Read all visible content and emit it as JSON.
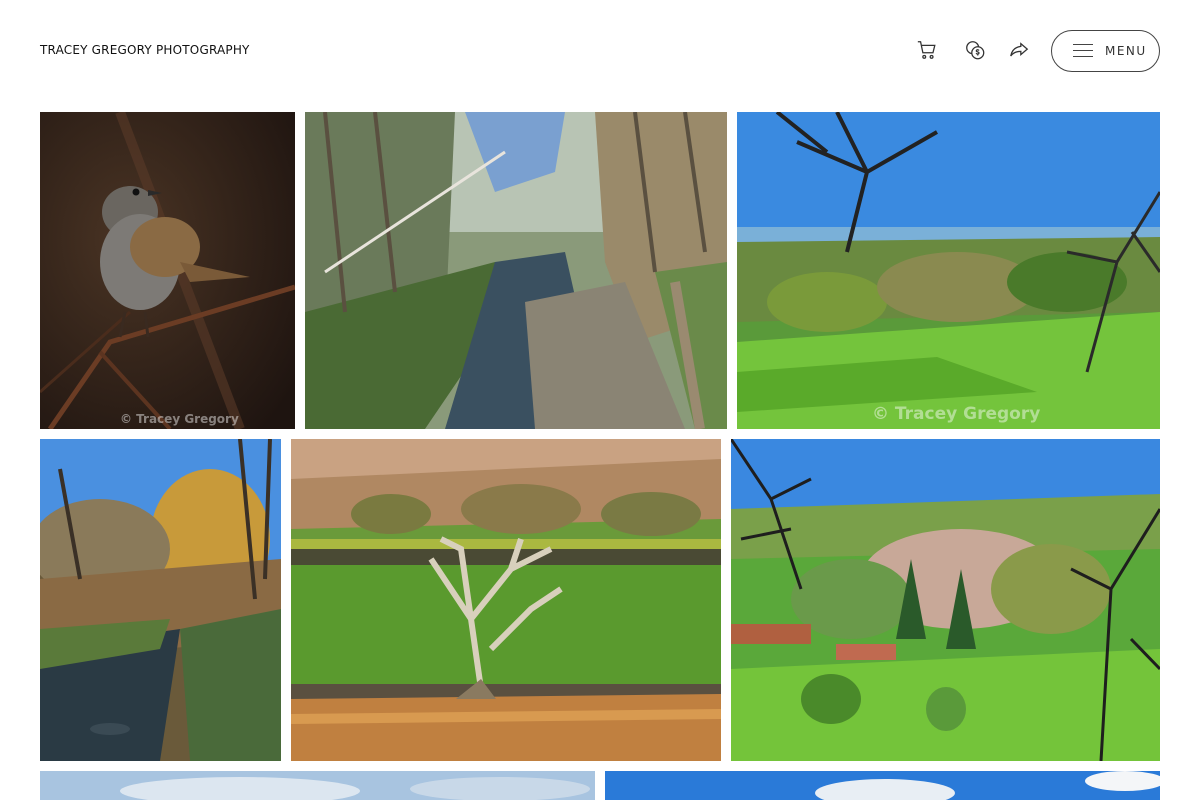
{
  "header": {
    "site_title": "TRACEY GREGORY PHOTOGRAPHY",
    "icons": [
      "cart-icon",
      "currency-icon",
      "share-icon"
    ],
    "menu_label": "MENU"
  },
  "gallery": {
    "watermark": "© Tracey Gregory",
    "photos": [
      {
        "subject": "dunnock-bird-on-branch"
      },
      {
        "subject": "woodland-stream-with-rocks"
      },
      {
        "subject": "green-valley-with-trees"
      },
      {
        "subject": "stream-in-autumn-woods"
      },
      {
        "subject": "dead-tree-in-moorland-field"
      },
      {
        "subject": "valley-village-springtime"
      },
      {
        "subject": "sky-landscape-partial"
      },
      {
        "subject": "sky-with-clouds-partial"
      }
    ]
  },
  "colors": {
    "background": "#ffffff",
    "text": "#111111",
    "border": "#444444"
  }
}
